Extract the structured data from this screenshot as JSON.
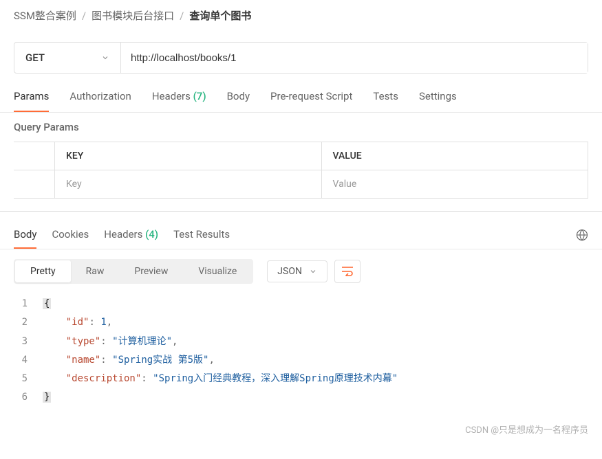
{
  "breadcrumb": {
    "items": [
      "SSM整合案例",
      "图书模块后台接口",
      "查询单个图书"
    ]
  },
  "request": {
    "method": "GET",
    "url": "http://localhost/books/1"
  },
  "tabs": [
    {
      "label": "Params",
      "count": null,
      "active": true
    },
    {
      "label": "Authorization",
      "count": null,
      "active": false
    },
    {
      "label": "Headers",
      "count": "(7)",
      "active": false
    },
    {
      "label": "Body",
      "count": null,
      "active": false
    },
    {
      "label": "Pre-request Script",
      "count": null,
      "active": false
    },
    {
      "label": "Tests",
      "count": null,
      "active": false
    },
    {
      "label": "Settings",
      "count": null,
      "active": false
    }
  ],
  "query_params": {
    "section_label": "Query Params",
    "headers": {
      "key": "KEY",
      "value": "VALUE"
    },
    "placeholder": {
      "key": "Key",
      "value": "Value"
    }
  },
  "response_tabs": [
    {
      "label": "Body",
      "count": null,
      "active": true
    },
    {
      "label": "Cookies",
      "count": null,
      "active": false
    },
    {
      "label": "Headers",
      "count": "(4)",
      "active": false
    },
    {
      "label": "Test Results",
      "count": null,
      "active": false
    }
  ],
  "view_modes": [
    {
      "label": "Pretty",
      "active": true
    },
    {
      "label": "Raw",
      "active": false
    },
    {
      "label": "Preview",
      "active": false
    },
    {
      "label": "Visualize",
      "active": false
    }
  ],
  "format": "JSON",
  "response_body": {
    "id": 1,
    "type": "计算机理论",
    "name": "Spring实战 第5版",
    "description": "Spring入门经典教程，深入理解Spring原理技术内幕"
  },
  "watermark": "CSDN @只是想成为一名程序员"
}
